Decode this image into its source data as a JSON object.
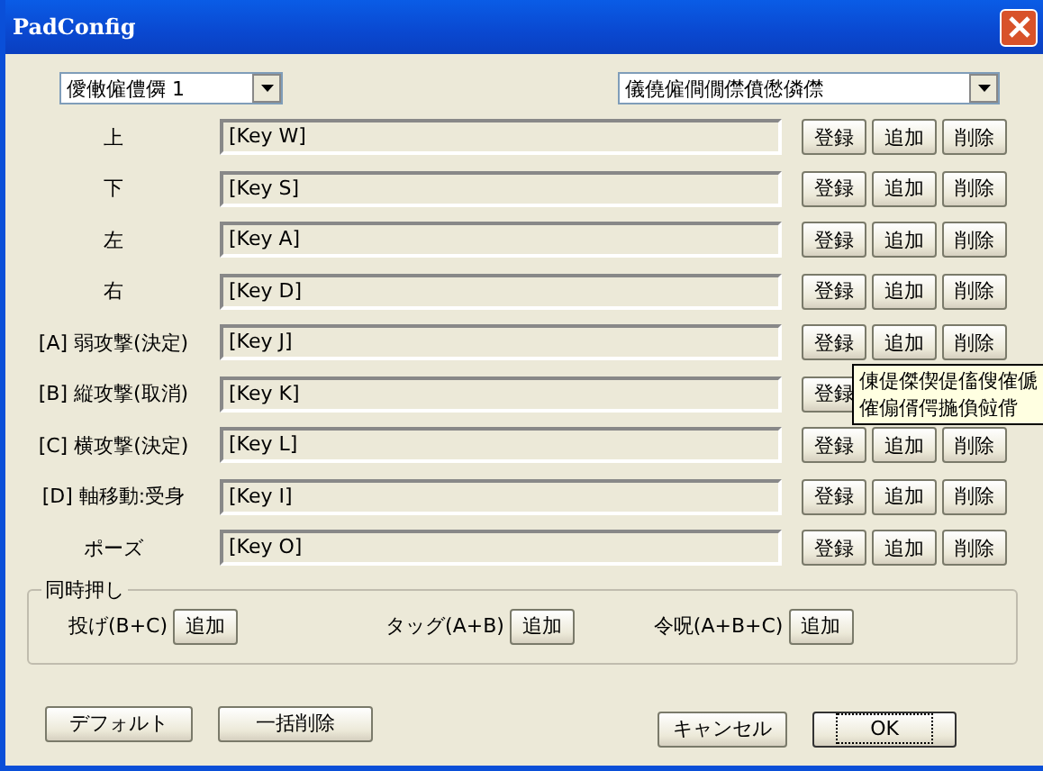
{
  "window": {
    "title": "PadConfig"
  },
  "selectors": [
    {
      "value": "僾僌僱僼僲 1"
    },
    {
      "value": "儀僥僱僴僩僸僨僽僯僸"
    }
  ],
  "bindings": [
    {
      "label": "上",
      "value": "[Key W]",
      "buttons": [
        "登録",
        "追加",
        "削除"
      ]
    },
    {
      "label": "下",
      "value": "[Key S]",
      "buttons": [
        "登録",
        "追加",
        "削除"
      ]
    },
    {
      "label": "左",
      "value": "[Key A]",
      "buttons": [
        "登録",
        "追加",
        "削除"
      ]
    },
    {
      "label": "右",
      "value": "[Key D]",
      "buttons": [
        "登録",
        "追加",
        "削除"
      ]
    },
    {
      "label": "[A] 弱攻撃(決定)",
      "value": "[Key J]",
      "buttons": [
        "登録",
        "追加",
        "削除"
      ]
    },
    {
      "label": "[B] 縦攻撃(取消)",
      "value": "[Key K]",
      "buttons": [
        "登録"
      ]
    },
    {
      "label": "[C] 横攻撃(決定)",
      "value": "[Key L]",
      "buttons": [
        "登録",
        "追加",
        "削除"
      ]
    },
    {
      "label": "[D] 軸移動:受身",
      "value": "[Key I]",
      "buttons": [
        "登録",
        "追加",
        "削除"
      ]
    },
    {
      "label": "ポーズ",
      "value": "[Key O]",
      "buttons": [
        "登録",
        "追加",
        "削除"
      ]
    }
  ],
  "combo_group": {
    "title": "同時押し",
    "items": [
      {
        "label": "投げ(B+C)",
        "button": "追加"
      },
      {
        "label": "タッグ(A+B)",
        "button": "追加"
      },
      {
        "label": "令呪(A+B+C)",
        "button": "追加"
      }
    ]
  },
  "tooltip": {
    "lines": [
      "倲偍傑偰偍傗傁傕傂",
      "傕傓偦偔揓偩傡偝"
    ]
  },
  "footer_left": [
    "デフォルト",
    "一括削除"
  ],
  "footer_right": [
    {
      "label": "キャンセル",
      "focused": false
    },
    {
      "label": "OK",
      "focused": true
    }
  ]
}
